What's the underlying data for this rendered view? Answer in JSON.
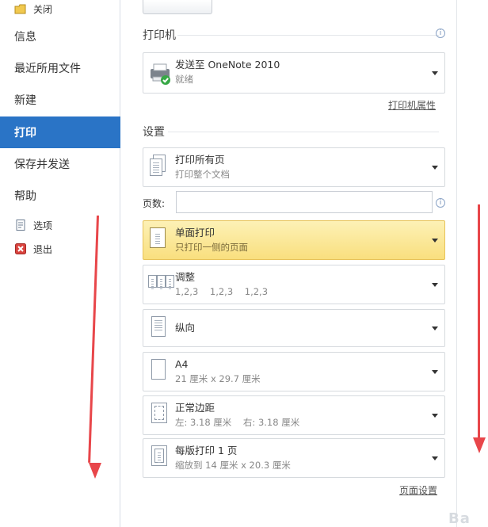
{
  "nav": {
    "close": "关闭",
    "info": "信息",
    "recent": "最近所用文件",
    "new": "新建",
    "print": "打印",
    "save_send": "保存并发送",
    "help": "帮助",
    "options": "选项",
    "exit": "退出"
  },
  "printer": {
    "section_title": "打印机",
    "name": "发送至 OneNote 2010",
    "status": "就绪",
    "properties_link": "打印机属性"
  },
  "settings": {
    "section_title": "设置",
    "print_range_title": "打印所有页",
    "print_range_sub": "打印整个文档",
    "pages_label": "页数:",
    "pages_value": "",
    "sides_title": "单面打印",
    "sides_sub": "只打印一侧的页面",
    "collate_title": "调整",
    "collate_sub": "1,2,3    1,2,3    1,2,3",
    "orientation_title": "纵向",
    "paper_title": "A4",
    "paper_sub": "21 厘米 x 29.7 厘米",
    "margins_title": "正常边距",
    "margins_sub": "左: 3.18 厘米    右: 3.18 厘米",
    "pages_per_sheet_title": "每版打印 1 页",
    "pages_per_sheet_sub": "缩放到 14 厘米 x 20.3 厘米",
    "page_setup_link": "页面设置"
  },
  "info_icon": "i",
  "watermark": "Ba",
  "colors": {
    "accent": "#2a74c6",
    "highlight": "#f9df7e",
    "annotation_arrow": "#e8464a"
  }
}
